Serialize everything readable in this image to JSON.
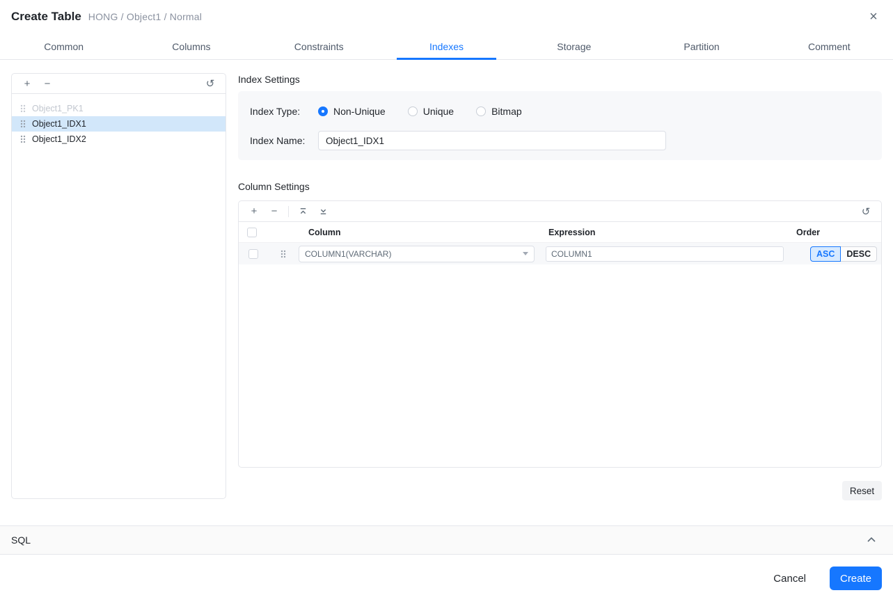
{
  "header": {
    "title": "Create Table",
    "breadcrumb": "HONG / Object1 / Normal",
    "close_icon": "×"
  },
  "tabs": [
    {
      "label": "Common",
      "active": false
    },
    {
      "label": "Columns",
      "active": false
    },
    {
      "label": "Constraints",
      "active": false
    },
    {
      "label": "Indexes",
      "active": true
    },
    {
      "label": "Storage",
      "active": false
    },
    {
      "label": "Partition",
      "active": false
    },
    {
      "label": "Comment",
      "active": false
    }
  ],
  "icons": {
    "plus": "+",
    "minus": "−",
    "refresh": "↺",
    "drag_handle": "drag-handle-dots",
    "move_top": "move-to-top",
    "move_bottom": "move-to-bottom",
    "collapse": "chevron-up"
  },
  "index_list": {
    "items": [
      {
        "label": "Object1_PK1",
        "state": "disabled"
      },
      {
        "label": "Object1_IDX1",
        "state": "selected"
      },
      {
        "label": "Object1_IDX2",
        "state": "normal"
      }
    ]
  },
  "index_settings": {
    "title": "Index Settings",
    "index_type_label": "Index Type:",
    "index_type_options": [
      {
        "label": "Non-Unique",
        "selected": true
      },
      {
        "label": "Unique",
        "selected": false
      },
      {
        "label": "Bitmap",
        "selected": false
      }
    ],
    "index_name_label": "Index Name:",
    "index_name_value": "Object1_IDX1"
  },
  "column_settings": {
    "title": "Column Settings",
    "headers": {
      "column": "Column",
      "expression": "Expression",
      "order": "Order"
    },
    "rows": [
      {
        "column": "COLUMN1(VARCHAR)",
        "expression": "COLUMN1",
        "order": "ASC",
        "order_options": {
          "asc": "ASC",
          "desc": "DESC"
        }
      }
    ]
  },
  "buttons": {
    "reset": "Reset",
    "cancel": "Cancel",
    "create": "Create"
  },
  "sql_section": {
    "label": "SQL"
  },
  "colors": {
    "accent": "#1677ff",
    "selected_row": "#d2e7fa",
    "panel_bg": "#f7f8fa",
    "border": "#e5e6eb",
    "asc_active_bg": "#d7eaff"
  }
}
